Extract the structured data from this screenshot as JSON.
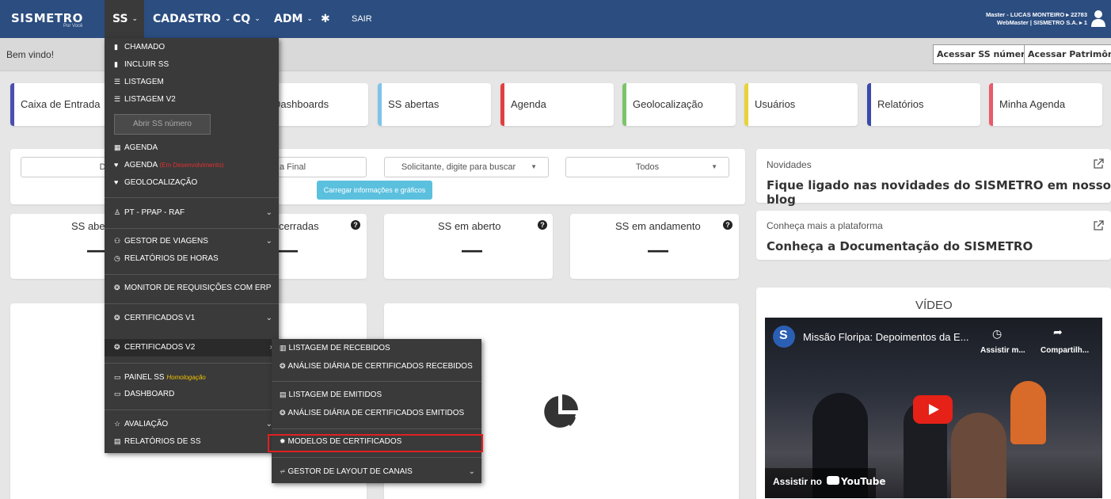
{
  "navbar": {
    "logo": "SISMETRO",
    "logo_sub": "Por Você",
    "menu": [
      {
        "label": "SS"
      },
      {
        "label": "CADASTRO"
      },
      {
        "label": "CQ"
      },
      {
        "label": "ADM"
      }
    ],
    "sair": "SAIR",
    "user_line1": "Master - LUCAS MONTEIRO ▸ 22783",
    "user_line2": "WebMaster | SISMETRO S.A. ▸ 1"
  },
  "subbar": {
    "welcome": "Bem vindo!",
    "btn_ss": "Acessar SS número",
    "btn_patrimonio": "Acessar Patrimônio"
  },
  "tiles": [
    {
      "label": "Caixa de Entrada",
      "color": "#4b4fb0"
    },
    {
      "label": "Dashboards",
      "color": "#aaaaaa"
    },
    {
      "label": "SS abertas",
      "color": "#7ec3ea"
    },
    {
      "label": "Agenda",
      "color": "#e24040"
    },
    {
      "label": "Geolocalização",
      "color": "#7cc46a"
    },
    {
      "label": "Usuários",
      "color": "#e8d33a"
    },
    {
      "label": "Relatórios",
      "color": "#3a4aa8"
    },
    {
      "label": "Minha Agenda",
      "color": "#e85a6a"
    }
  ],
  "filters": {
    "data_inicial": "Data I",
    "data_final": "a Final",
    "solicitante": "Solicitante, digite para buscar",
    "todos": "Todos",
    "load_btn": "Carregar informações e gráficos"
  },
  "stats": [
    {
      "title": "SS aber",
      "value": "—"
    },
    {
      "title": "cerradas",
      "value": "—"
    },
    {
      "title": "SS em aberto",
      "value": "—"
    },
    {
      "title": "SS em andamento",
      "value": "—"
    }
  ],
  "news": {
    "label": "Novidades",
    "title": "Fique ligado nas novidades do SISMETRO em nosso blog"
  },
  "docs": {
    "label": "Conheça mais a plataforma",
    "title": "Conheça a Documentação do SISMETRO"
  },
  "video": {
    "heading": "VÍDEO",
    "title": "Missão Floripa: Depoimentos da E...",
    "watch_later": "Assistir m...",
    "share": "Compartilh...",
    "watch_on": "Assistir no",
    "youtube": "YouTube"
  },
  "dropdown": {
    "chamado": "CHAMADO",
    "incluir": "INCLUIR SS",
    "listagem": "LISTAGEM",
    "listagem_v2": "LISTAGEM V2",
    "abrir": "Abrir SS número",
    "agenda": "AGENDA",
    "agenda2": "AGENDA",
    "agenda2_tag": "(Em Desenvolvimento)",
    "geo": "GEOLOCALIZAÇÃO",
    "pt": "PT - PPAP - RAF",
    "gestor_viagens": "GESTOR DE VIAGENS",
    "relatorios_horas": "RELATÓRIOS DE HORAS",
    "monitor": "MONITOR DE REQUISIÇÕES COM ERP",
    "cert_v1": "CERTIFICADOS V1",
    "cert_v2": "CERTIFICADOS V2",
    "painel": "PAINEL SS",
    "painel_tag": "Homologação",
    "dashboard": "DASHBOARD",
    "avaliacao": "AVALIAÇÃO",
    "relatorios_ss": "RELATÓRIOS DE SS"
  },
  "submenu": {
    "listagem_recebidos": "LISTAGEM DE RECEBIDOS",
    "analise_recebidos": "ANÁLISE DIÁRIA DE CERTIFICADOS RECEBIDOS",
    "listagem_emitidos": "LISTAGEM DE EMITIDOS",
    "analise_emitidos": "ANÁLISE DIÁRIA DE CERTIFICADOS EMITIDOS",
    "modelos": "MODELOS DE CERTIFICADOS",
    "gestor_layout": "GESTOR DE LAYOUT DE CANAIS"
  }
}
